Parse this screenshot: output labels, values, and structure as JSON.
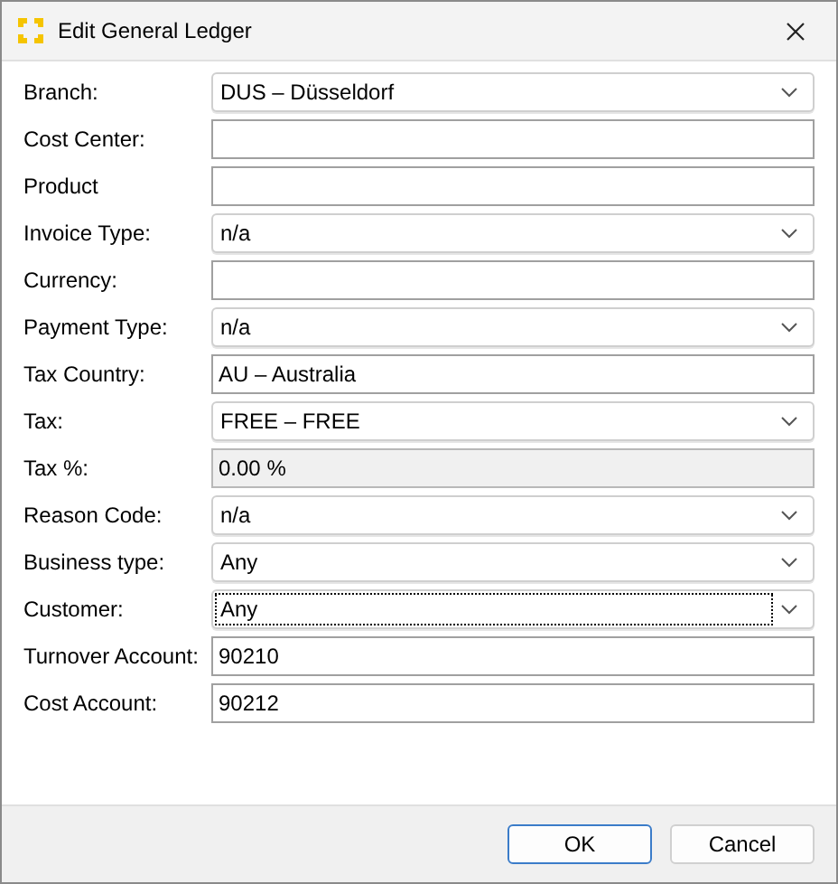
{
  "window": {
    "title": "Edit General Ledger"
  },
  "fields": [
    {
      "label": "Branch:",
      "kind": "combo",
      "value": "DUS – Düsseldorf",
      "focused": false
    },
    {
      "label": "Cost Center:",
      "kind": "text",
      "focused": false
    },
    {
      "label": "Product",
      "kind": "text",
      "focused": false
    },
    {
      "label": "Invoice Type:",
      "kind": "combo",
      "value": "n/a",
      "focused": false
    },
    {
      "label": "Currency:",
      "kind": "text",
      "focused": false
    },
    {
      "label": "Payment Type:",
      "kind": "combo",
      "value": "n/a",
      "focused": false
    },
    {
      "label": "Tax Country:",
      "kind": "text",
      "value": "AU – Australia",
      "focused": false
    },
    {
      "label": "Tax:",
      "kind": "combo",
      "value": "FREE – FREE",
      "focused": false
    },
    {
      "label": "Tax %:",
      "kind": "readonly",
      "value": "0.00 %",
      "focused": false
    },
    {
      "label": "Reason Code:",
      "kind": "combo",
      "value": "n/a",
      "focused": false
    },
    {
      "label": "Business type:",
      "kind": "combo",
      "value": "Any",
      "focused": false
    },
    {
      "label": "Customer:",
      "kind": "combo",
      "value": "Any",
      "focused": true
    },
    {
      "label": "Turnover Account:",
      "kind": "text",
      "value": "90210",
      "focused": false
    },
    {
      "label": "Cost Account:",
      "kind": "text",
      "value": "90212",
      "focused": false
    }
  ],
  "buttons": [
    {
      "label": "OK",
      "default": true
    },
    {
      "label": "Cancel",
      "default": false
    }
  ]
}
